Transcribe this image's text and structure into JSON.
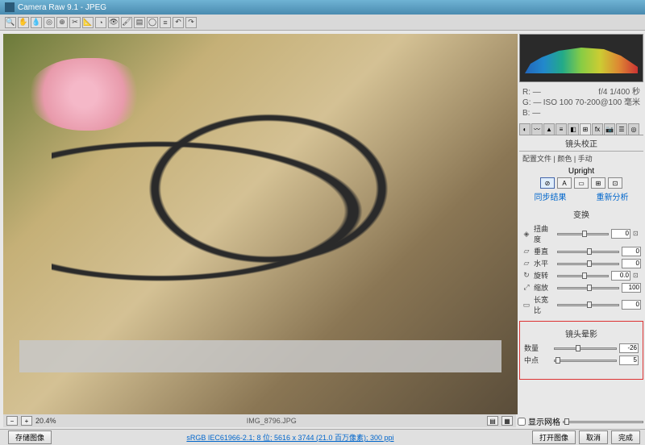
{
  "app": {
    "title": "Camera Raw 9.1 - JPEG"
  },
  "exif": {
    "r": "R: —",
    "g": "G: —",
    "b": "B: —",
    "shutter": "f/4  1/400 秒",
    "iso": "ISO 100  70-200@100 毫米"
  },
  "panel": {
    "title": "镜头校正",
    "breadcrumb": "配置文件 | 颜色 | 手动",
    "upright": "Upright",
    "link1": "同步结果",
    "link2": "重新分析",
    "transform": "变换",
    "vignette": "镜头晕影"
  },
  "upright_modes": [
    "⊘",
    "A",
    "▭",
    "⊞",
    "⊡"
  ],
  "sliders": {
    "distortion": {
      "label": "扭曲度",
      "value": "0"
    },
    "vertical": {
      "label": "垂直",
      "value": "0"
    },
    "horizontal": {
      "label": "水平",
      "value": "0"
    },
    "rotate": {
      "label": "旋转",
      "value": "0.0"
    },
    "scale": {
      "label": "缩放",
      "value": "100"
    },
    "aspect": {
      "label": "长宽比",
      "value": "0"
    },
    "amount": {
      "label": "数量",
      "value": "-26"
    },
    "midpoint": {
      "label": "中点",
      "value": "5"
    }
  },
  "zoom": {
    "value": "20.4%"
  },
  "filename": "IMG_8796.JPG",
  "grid": {
    "label": "显示网格"
  },
  "status": {
    "saveimg": "存储图像",
    "link": "sRGB IEC61966-2.1; 8 位; 5616 x 3744 (21.0 百万像素); 300 ppi",
    "open": "打开图像",
    "cancel": "取消",
    "done": "完成"
  }
}
